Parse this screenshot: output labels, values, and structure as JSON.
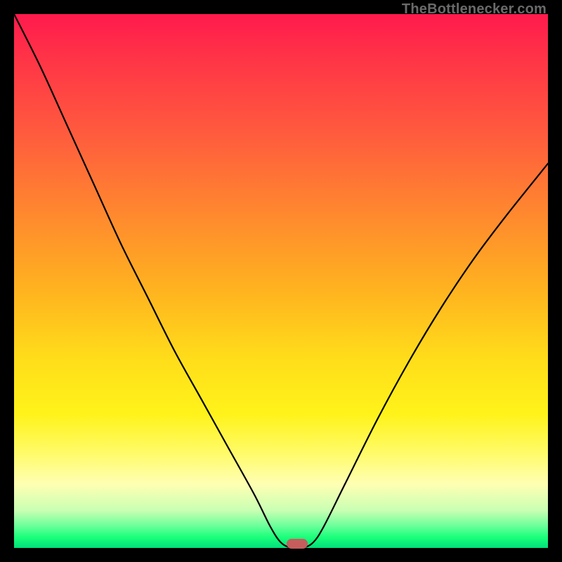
{
  "caption": "TheBottlenecker.com",
  "colors": {
    "marker": "#c55d5d",
    "curve": "#000000"
  },
  "chart_data": {
    "type": "line",
    "title": "",
    "xlabel": "",
    "ylabel": "",
    "xlim": [
      0,
      100
    ],
    "ylim": [
      0,
      100
    ],
    "grid": false,
    "series": [
      {
        "name": "bottleneck-curve",
        "x": [
          0,
          5,
          10,
          15,
          20,
          25,
          30,
          35,
          40,
          45,
          48,
          50,
          52,
          54,
          56,
          58,
          62,
          68,
          74,
          80,
          86,
          92,
          100
        ],
        "values": [
          100,
          90,
          79,
          68,
          57,
          47,
          37,
          28,
          19,
          10,
          4,
          1,
          0,
          0,
          1,
          4,
          12,
          24,
          35,
          45,
          54,
          62,
          72
        ]
      }
    ],
    "annotations": [
      {
        "name": "optimal-marker",
        "x": 53,
        "y": 0,
        "shape": "pill",
        "color": "#c55d5d"
      }
    ]
  }
}
